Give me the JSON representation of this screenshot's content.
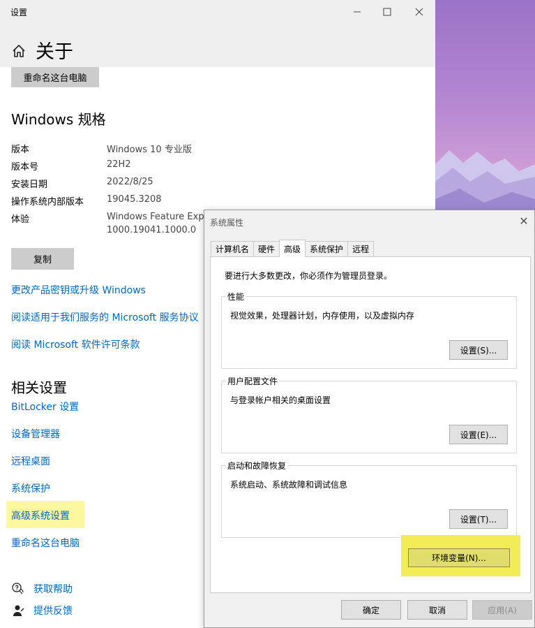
{
  "settings": {
    "window_title": "设置",
    "page_title": "关于",
    "rename_top": "重命名这台电脑",
    "spec_heading": "Windows 规格",
    "specs": [
      {
        "label": "版本",
        "value": "Windows 10 专业版"
      },
      {
        "label": "版本号",
        "value": "22H2"
      },
      {
        "label": "安装日期",
        "value": "2022/8/25"
      },
      {
        "label": "操作系统内部版本",
        "value": "19045.3208"
      },
      {
        "label": "体验",
        "value": "Windows Feature Expe",
        "value2": "1000.19041.1000.0"
      }
    ],
    "copy_label": "复制",
    "links": [
      "更改产品密钥或升级 Windows",
      "阅读适用于我们服务的 Microsoft 服务协议",
      "阅读 Microsoft 软件许可条款"
    ],
    "related_heading": "相关设置",
    "related": [
      "BitLocker 设置",
      "设备管理器",
      "远程桌面",
      "系统保护",
      "高级系统设置",
      "重命名这台电脑"
    ],
    "help": "获取帮助",
    "feedback": "提供反馈"
  },
  "dialog": {
    "title": "系统属性",
    "close_glyph": "✕",
    "tabs": [
      "计算机名",
      "硬件",
      "高级",
      "系统保护",
      "远程"
    ],
    "active_tab": "高级",
    "note": "要进行大多数更改，你必须作为管理员登录。",
    "performance": {
      "title": "性能",
      "desc": "视觉效果，处理器计划，内存使用，以及虚拟内存",
      "button": "设置(S)..."
    },
    "profiles": {
      "title": "用户配置文件",
      "desc": "与登录帐户相关的桌面设置",
      "button": "设置(E)..."
    },
    "startup": {
      "title": "启动和故障恢复",
      "desc": "系统启动、系统故障和调试信息",
      "button": "设置(T)..."
    },
    "env_button": "环境变量(N)...",
    "ok": "确定",
    "cancel": "取消",
    "apply": "应用(A)"
  },
  "colors": {
    "link": "#0067c0",
    "highlight": "#fbf8a0",
    "env_highlight": "#f2ec57"
  }
}
